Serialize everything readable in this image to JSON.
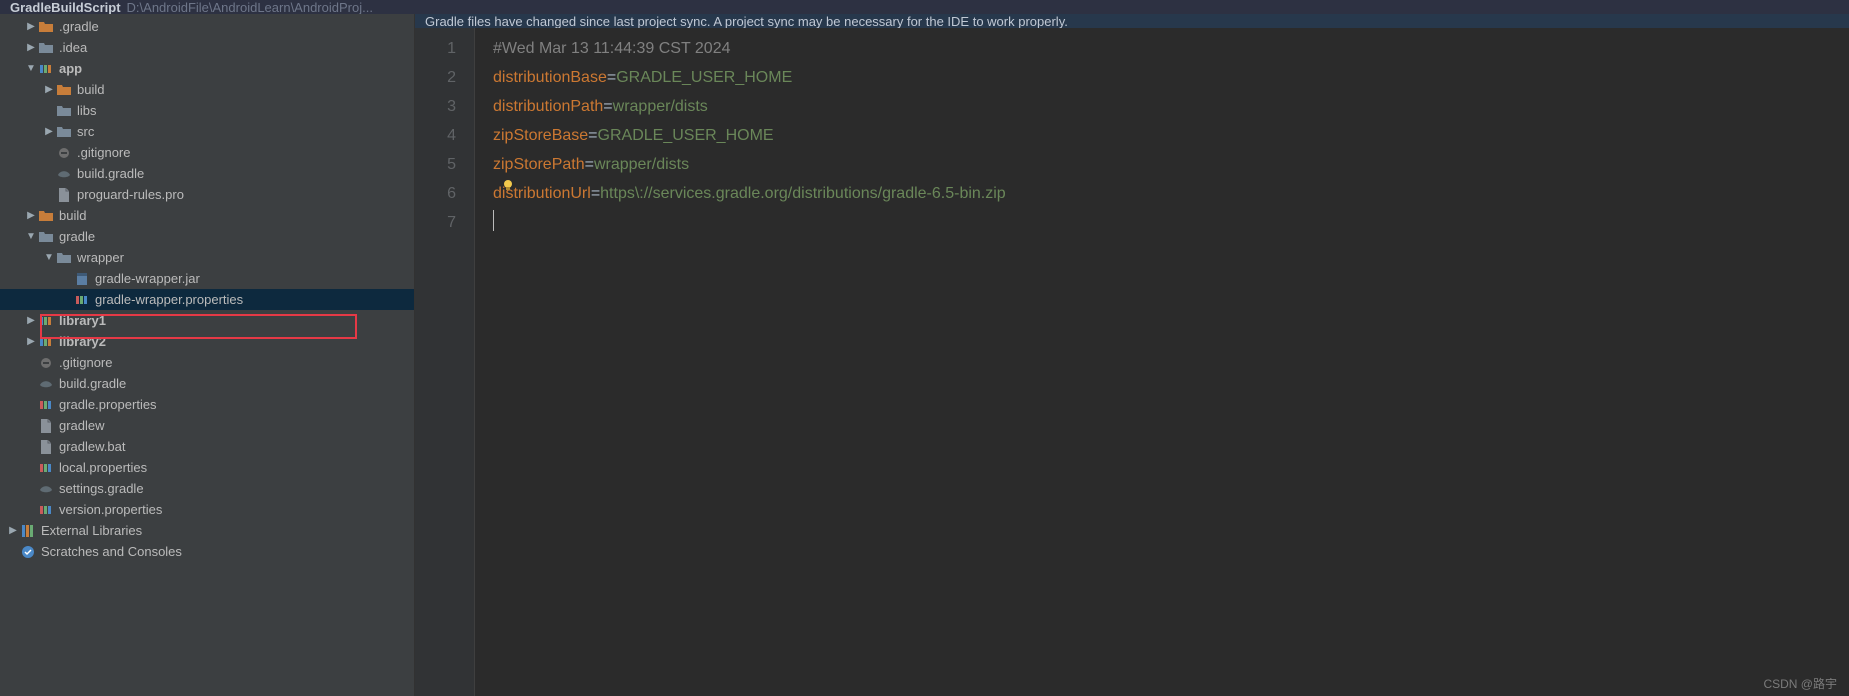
{
  "header": {
    "project": "GradleBuildScript",
    "path": "D:\\AndroidFile\\AndroidLearn\\AndroidProj..."
  },
  "banner": {
    "text": "Gradle files have changed since last project sync. A project sync may be necessary for the IDE to work properly."
  },
  "tree": [
    {
      "indent": 1,
      "arrow": "right",
      "icon": "folder-orange",
      "label": ".gradle"
    },
    {
      "indent": 1,
      "arrow": "right",
      "icon": "folder-grey",
      "label": ".idea"
    },
    {
      "indent": 1,
      "arrow": "down",
      "icon": "module",
      "label": "app",
      "bold": true
    },
    {
      "indent": 2,
      "arrow": "right",
      "icon": "folder-orange",
      "label": "build"
    },
    {
      "indent": 2,
      "arrow": "",
      "icon": "folder-grey",
      "label": "libs"
    },
    {
      "indent": 2,
      "arrow": "right",
      "icon": "folder-grey",
      "label": "src"
    },
    {
      "indent": 2,
      "arrow": "",
      "icon": "gitignore",
      "label": ".gitignore"
    },
    {
      "indent": 2,
      "arrow": "",
      "icon": "gradle",
      "label": "build.gradle"
    },
    {
      "indent": 2,
      "arrow": "",
      "icon": "file",
      "label": "proguard-rules.pro"
    },
    {
      "indent": 1,
      "arrow": "right",
      "icon": "folder-orange",
      "label": "build"
    },
    {
      "indent": 1,
      "arrow": "down",
      "icon": "folder-grey",
      "label": "gradle"
    },
    {
      "indent": 2,
      "arrow": "down",
      "icon": "folder-grey",
      "label": "wrapper"
    },
    {
      "indent": 3,
      "arrow": "",
      "icon": "jar",
      "label": "gradle-wrapper.jar"
    },
    {
      "indent": 3,
      "arrow": "",
      "icon": "properties",
      "label": "gradle-wrapper.properties",
      "selected": true
    },
    {
      "indent": 1,
      "arrow": "right",
      "icon": "module",
      "label": "library1",
      "bold": true
    },
    {
      "indent": 1,
      "arrow": "right",
      "icon": "module",
      "label": "library2",
      "bold": true
    },
    {
      "indent": 1,
      "arrow": "",
      "icon": "gitignore",
      "label": ".gitignore"
    },
    {
      "indent": 1,
      "arrow": "",
      "icon": "gradle",
      "label": "build.gradle"
    },
    {
      "indent": 1,
      "arrow": "",
      "icon": "properties",
      "label": "gradle.properties"
    },
    {
      "indent": 1,
      "arrow": "",
      "icon": "file",
      "label": "gradlew"
    },
    {
      "indent": 1,
      "arrow": "",
      "icon": "file",
      "label": "gradlew.bat"
    },
    {
      "indent": 1,
      "arrow": "",
      "icon": "properties",
      "label": "local.properties"
    },
    {
      "indent": 1,
      "arrow": "",
      "icon": "gradle",
      "label": "settings.gradle"
    },
    {
      "indent": 1,
      "arrow": "",
      "icon": "properties",
      "label": "version.properties"
    },
    {
      "indent": 0,
      "arrow": "right",
      "icon": "lib",
      "label": "External Libraries"
    },
    {
      "indent": 0,
      "arrow": "",
      "icon": "scratch",
      "label": "Scratches and Consoles"
    }
  ],
  "editor": {
    "lines": [
      "1",
      "2",
      "3",
      "4",
      "5",
      "6",
      "7"
    ],
    "content": [
      {
        "type": "comment",
        "text": "#Wed Mar 13 11:44:39 CST 2024"
      },
      {
        "type": "kv",
        "key": "distributionBase",
        "val": "GRADLE_USER_HOME"
      },
      {
        "type": "kv",
        "key": "distributionPath",
        "val": "wrapper/dists"
      },
      {
        "type": "kv",
        "key": "zipStoreBase",
        "val": "GRADLE_USER_HOME"
      },
      {
        "type": "kv",
        "key": "zipStorePath",
        "val": "wrapper/dists"
      },
      {
        "type": "kv",
        "key": "distributionUrl",
        "val": "https\\://services.gradle.org/distributions/gradle-6.5-bin.zip"
      },
      {
        "type": "empty"
      }
    ]
  },
  "watermark": "CSDN @路宇"
}
